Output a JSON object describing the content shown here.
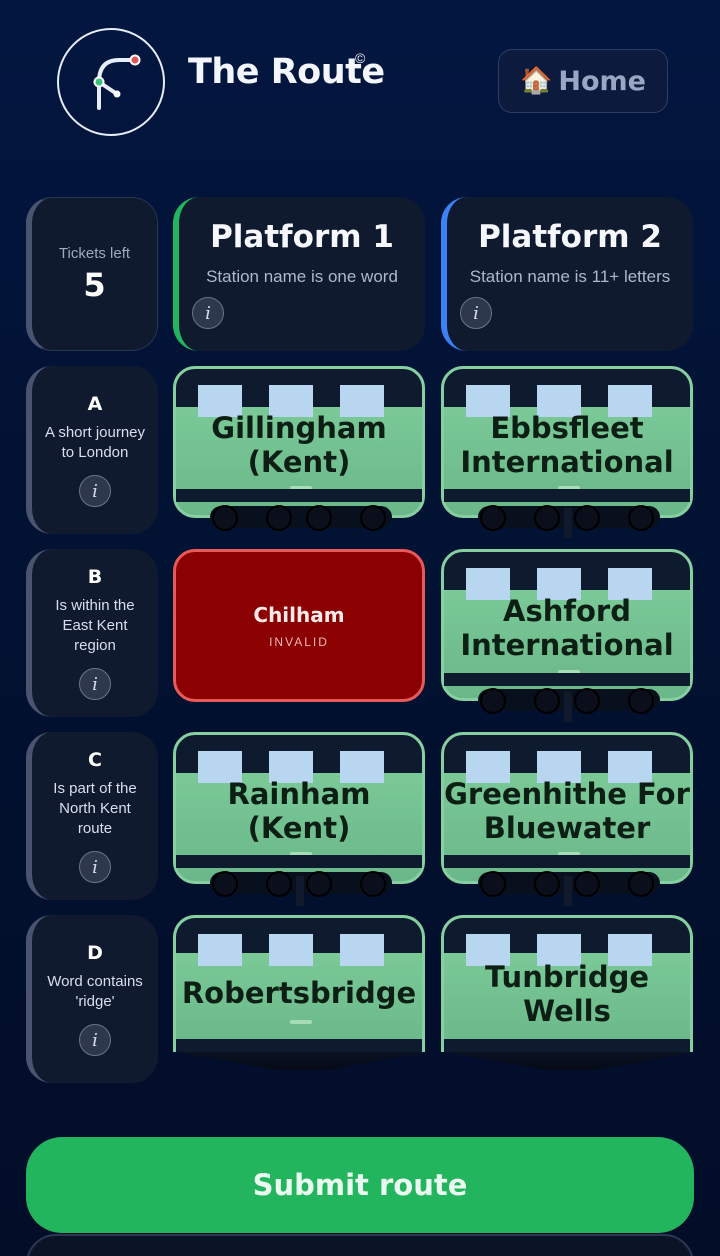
{
  "header": {
    "title": "The Route",
    "copyright": "©",
    "home_icon": "house-emoji",
    "home_label": "Home"
  },
  "tickets": {
    "label": "Tickets left",
    "value": "5"
  },
  "platforms": [
    {
      "title": "Platform 1",
      "rule": "Station name is one word",
      "accent": "#22b55e"
    },
    {
      "title": "Platform 2",
      "rule": "Station name is 11+ letters",
      "accent": "#3b82f6"
    }
  ],
  "info_glyph": "i",
  "rows": [
    {
      "letter": "A",
      "clue": "A short journey to London"
    },
    {
      "letter": "B",
      "clue": "Is within the East Kent region"
    },
    {
      "letter": "C",
      "clue": "Is part of the North Kent route"
    },
    {
      "letter": "D",
      "clue": "Word contains 'ridge'"
    }
  ],
  "cells": {
    "a1": {
      "name": "Gillingham (Kent)",
      "status": "valid"
    },
    "a2": {
      "name": "Ebbsfleet International",
      "status": "valid"
    },
    "b1": {
      "name": "Chilham",
      "status": "invalid",
      "label": "INVALID"
    },
    "b2": {
      "name": "Ashford International",
      "status": "valid"
    },
    "c1": {
      "name": "Rainham (Kent)",
      "status": "valid"
    },
    "c2": {
      "name": "Greenhithe For Bluewater",
      "status": "valid"
    },
    "d1": {
      "name": "Robertsbridge",
      "status": "valid"
    },
    "d2": {
      "name": "Tunbridge Wells",
      "status": "valid"
    }
  },
  "submit": {
    "label": "Submit route",
    "color": "#22b55e"
  },
  "colors": {
    "valid": "#7ac997",
    "invalid": "#8b0000",
    "background": "#031640"
  }
}
